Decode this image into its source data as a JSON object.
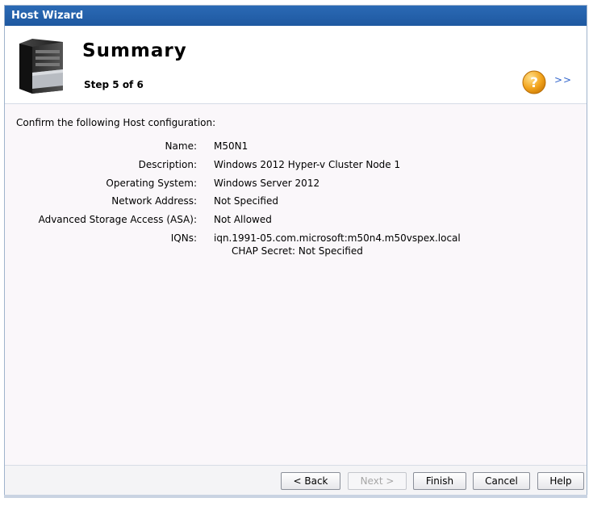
{
  "window": {
    "title": "Host Wizard"
  },
  "header": {
    "title": "Summary",
    "step": "Step 5 of 6",
    "more_link": ">>",
    "icon": "server-tower-icon"
  },
  "summary": {
    "intro": "Confirm the following Host configuration:",
    "fields": [
      {
        "label": "Name:",
        "value": "M50N1"
      },
      {
        "label": "Description:",
        "value": "Windows 2012 Hyper-v Cluster Node 1"
      },
      {
        "label": "Operating System:",
        "value": "Windows Server 2012"
      },
      {
        "label": "Network Address:",
        "value": "Not Specified"
      },
      {
        "label": "Advanced Storage Access (ASA):",
        "value": "Not Allowed"
      },
      {
        "label": "IQNs:",
        "value": "iqn.1991-05.com.microsoft:m50n4.m50vspex.local"
      }
    ],
    "chap_secret": "CHAP Secret: Not Specified"
  },
  "buttons": {
    "back": "< Back",
    "next": "Next >",
    "finish": "Finish",
    "cancel": "Cancel",
    "help": "Help"
  },
  "colors": {
    "titlebar": "#1e58a0",
    "help_icon": "#f2a31b",
    "link": "#3366cc"
  }
}
